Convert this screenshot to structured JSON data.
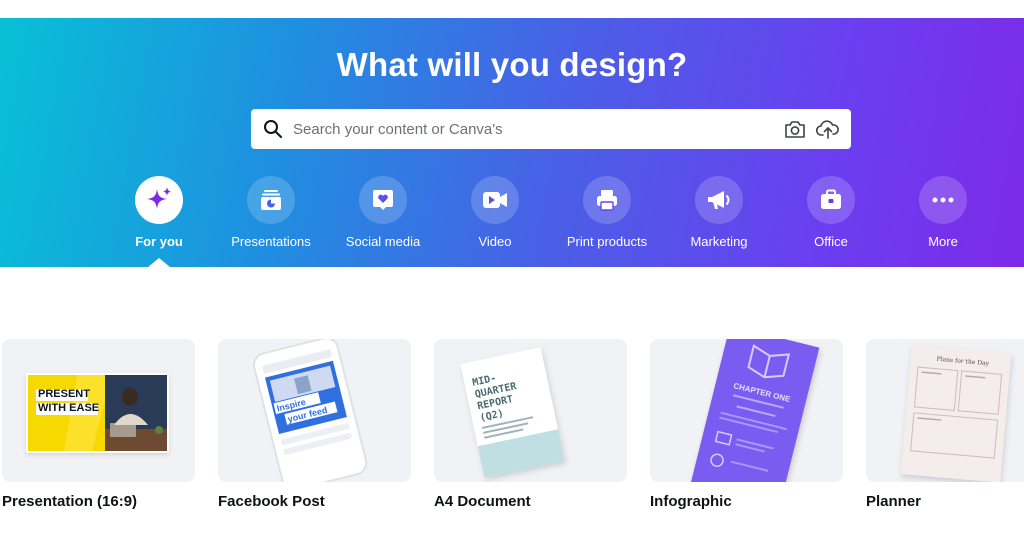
{
  "hero": {
    "title": "What will you design?",
    "search_placeholder": "Search your content or Canva's"
  },
  "categories": [
    {
      "label": "For you",
      "icon": "sparkle-icon",
      "active": true
    },
    {
      "label": "Presentations",
      "icon": "presentation-icon"
    },
    {
      "label": "Social media",
      "icon": "heart-icon"
    },
    {
      "label": "Video",
      "icon": "video-camera-icon"
    },
    {
      "label": "Print products",
      "icon": "printer-icon"
    },
    {
      "label": "Marketing",
      "icon": "megaphone-icon"
    },
    {
      "label": "Office",
      "icon": "briefcase-icon"
    },
    {
      "label": "More",
      "icon": "more-dots-icon"
    }
  ],
  "designs": [
    {
      "label": "Presentation (16:9)",
      "thumb_text": [
        "PRESENT",
        "WITH EASE"
      ]
    },
    {
      "label": "Facebook Post",
      "thumb_text": [
        "Inspire",
        "your feed"
      ]
    },
    {
      "label": "A4 Document",
      "thumb_text": [
        "MID-",
        "QUARTER",
        "REPORT",
        "(Q2)"
      ]
    },
    {
      "label": "Infographic",
      "thumb_text": [
        "CHAPTER ONE"
      ]
    },
    {
      "label": "Planner",
      "thumb_text": [
        "Plans for the Day"
      ]
    }
  ],
  "colors": {
    "gradient_start": "#08c0d6",
    "gradient_end": "#7d2ae8",
    "accent_purple": "#7d2ae8",
    "presentation_yellow": "#f5d900",
    "infographic_purple": "#7b5cf0"
  }
}
